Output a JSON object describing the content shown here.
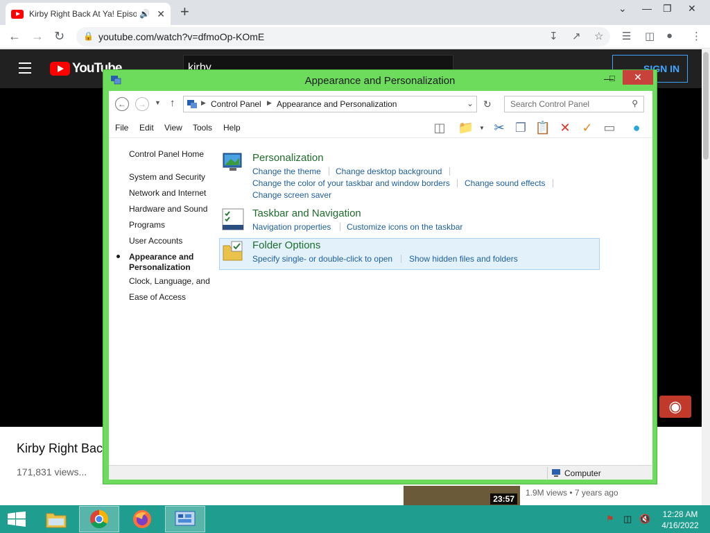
{
  "browser": {
    "tab_title": "Kirby Right Back At Ya! Episode",
    "url": "youtube.com/watch?v=dfmoOp-KOmE",
    "new_tab": "+"
  },
  "youtube": {
    "logo_text": "YouTube",
    "search_query": "kirby",
    "sign_in": "SIGN IN",
    "video_title": "Kirby Right Back",
    "views": "171,831 views...",
    "title_tail": ")",
    "thumb_duration": "23:57",
    "thumb_meta": "1.9M views • 7 years ago"
  },
  "window": {
    "title": "Appearance and Personalization",
    "accent_color": "#6ddc5d",
    "close_color": "#c7423b"
  },
  "address": {
    "crumbs": [
      "Control Panel",
      "Appearance and Personalization"
    ],
    "search_placeholder": "Search Control Panel"
  },
  "menu": [
    "File",
    "Edit",
    "View",
    "Tools",
    "Help"
  ],
  "sidebar": {
    "home": "Control Panel Home",
    "items": [
      "System and Security",
      "Network and Internet",
      "Hardware and Sound",
      "Programs",
      "User Accounts",
      "Appearance and Personalization",
      "Clock, Language, and",
      "Ease of Access"
    ],
    "active_line1": "Appearance and",
    "active_line2": "Personalization"
  },
  "categories": [
    {
      "title": "Personalization",
      "icon": "personalization-icon",
      "links": [
        "Change the theme",
        "Change desktop background",
        "Change the color of your taskbar and window borders",
        "Change sound effects",
        "Change screen saver"
      ]
    },
    {
      "title": "Taskbar and Navigation",
      "icon": "taskbar-icon",
      "links": [
        "Navigation properties",
        "Customize icons on the taskbar"
      ]
    },
    {
      "title": "Folder Options",
      "icon": "folder-options-icon",
      "links": [
        "Specify single- or double-click to open",
        "Show hidden files and folders"
      ]
    }
  ],
  "status": {
    "location": "Computer"
  },
  "taskbar": {
    "color": "#1f9d8e",
    "time": "12:28 AM",
    "date": "4/16/2022"
  }
}
